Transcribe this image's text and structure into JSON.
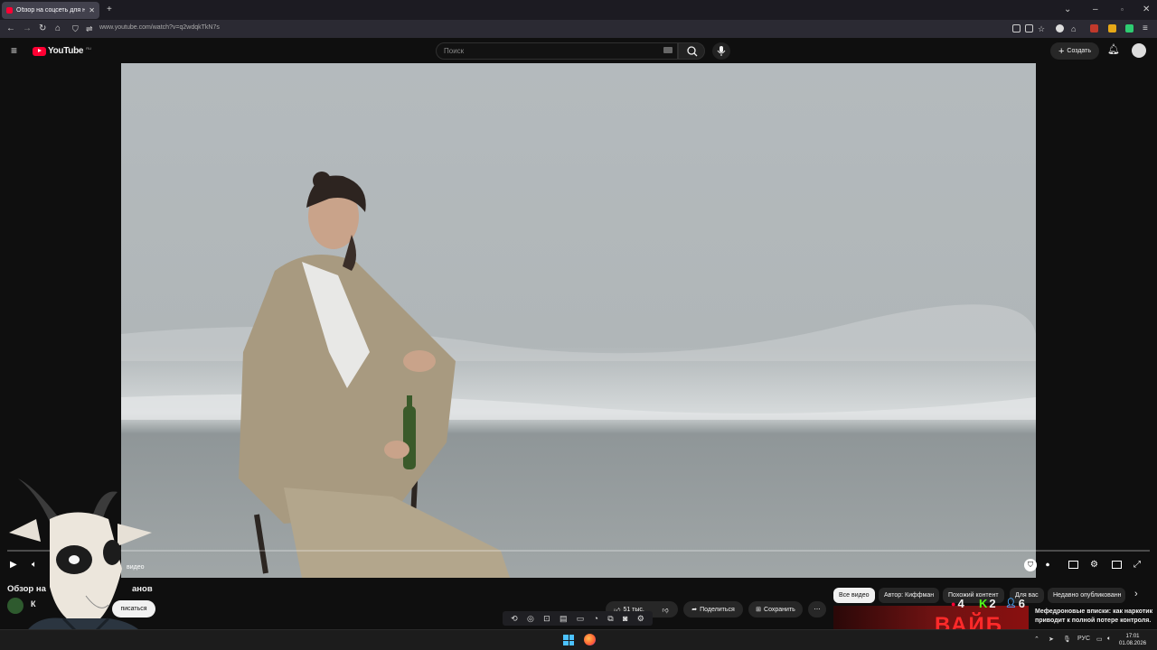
{
  "browser": {
    "tab_title": "Обзор на соцсеть для наркома",
    "url": "www.youtube.com/watch?v=q2wdqkTkN7s"
  },
  "youtube": {
    "logo_text": "YouTube",
    "region": "RU",
    "search_placeholder": "Поиск",
    "create_label": "Создать"
  },
  "player": {
    "progress": 0.0,
    "overlay_text": "видео"
  },
  "video_info": {
    "title_start": "Обзор на",
    "title_end": "анов",
    "channel_initial": "К",
    "subscribe_label": "писаться",
    "likes": "51 тыс.",
    "share_label": "Поделиться",
    "save_label": "Сохранить"
  },
  "chips": [
    {
      "label": "Все видео",
      "active": true
    },
    {
      "label": "Автор: Киффман",
      "active": false
    },
    {
      "label": "Похожий контент",
      "active": false
    },
    {
      "label": "Для вас",
      "active": false
    },
    {
      "label": "Недавно опубликованн",
      "active": false
    }
  ],
  "recommendation": {
    "thumb_text": "ВАЙБ",
    "title": "Мефедроновые вписки: как наркотик приводит к полной потере контроля."
  },
  "stream_stats": [
    {
      "icon": "youtube-icon",
      "value": "4",
      "color": "#ff0033"
    },
    {
      "icon": "kick-icon",
      "value": "2",
      "color": "#53fc18"
    },
    {
      "icon": "viewers-icon",
      "value": "6",
      "color": "#4aa8ff"
    }
  ],
  "taskbar": {
    "lang": "РУС",
    "time": "17:01",
    "date": "01.08.2026"
  },
  "colors": {
    "accent": "#ff0033",
    "bg": "#0f0f0f"
  }
}
